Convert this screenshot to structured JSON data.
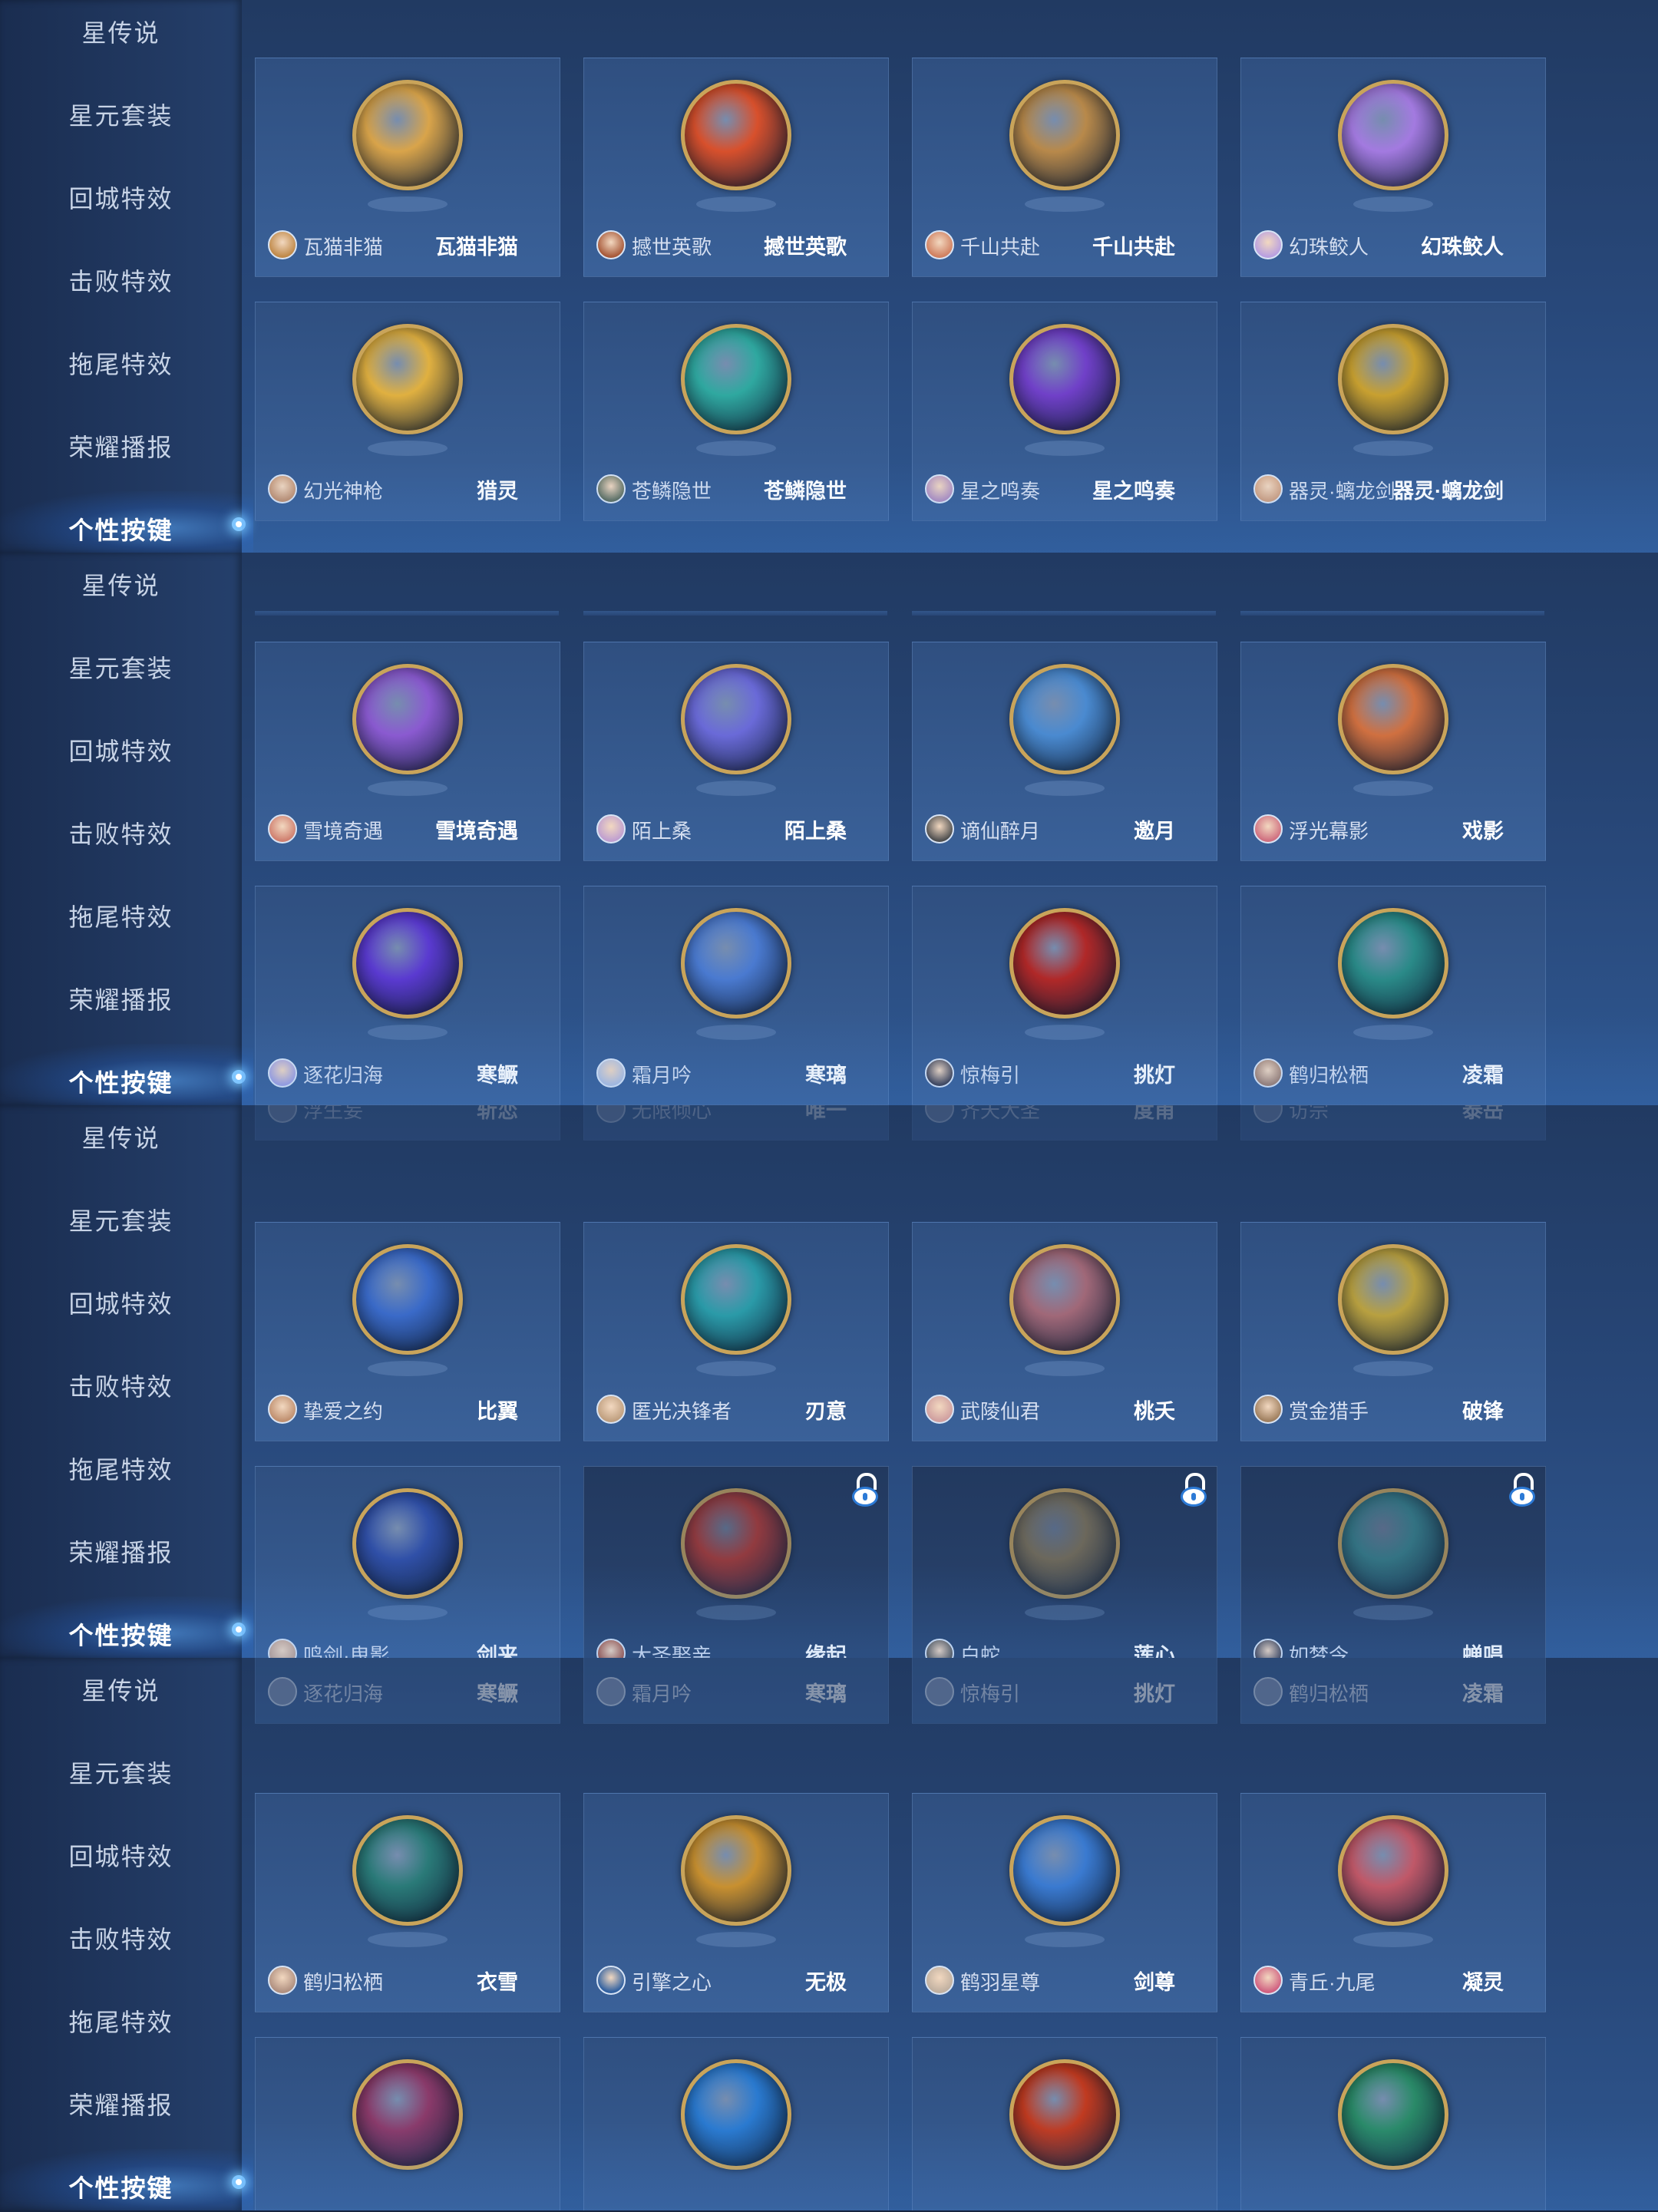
{
  "sidebar": {
    "items": [
      "星传说",
      "星元套装",
      "回城特效",
      "击败特效",
      "拖尾特效",
      "荣耀播报",
      "个性按键"
    ],
    "active": "个性按键"
  },
  "panels": [
    {
      "cards": [
        {
          "hero": "瓦猫非猫",
          "skin": "瓦猫非猫",
          "emblem_color": "#d9a44a",
          "avatar_color": "#c08a4a"
        },
        {
          "hero": "撼世英歌",
          "skin": "撼世英歌",
          "emblem_color": "#d8502c",
          "avatar_color": "#a85a3a"
        },
        {
          "hero": "千山共赴",
          "skin": "千山共赴",
          "emblem_color": "#b8894a",
          "avatar_color": "#d08060"
        },
        {
          "hero": "幻珠鲛人",
          "skin": "幻珠鲛人",
          "emblem_color": "#a37ae0",
          "avatar_color": "#b9a0e0"
        },
        {
          "hero": "幻光神枪",
          "skin": "猎灵",
          "emblem_color": "#e0b040",
          "avatar_color": "#c09070"
        },
        {
          "hero": "苍鳞隐世",
          "skin": "苍鳞隐世",
          "emblem_color": "#2fa8a0",
          "avatar_color": "#607060"
        },
        {
          "hero": "星之鸣奏",
          "skin": "星之鸣奏",
          "emblem_color": "#7040c8",
          "avatar_color": "#b090c0"
        },
        {
          "hero": "器灵·螭龙剑",
          "skin": "器灵·螭龙剑",
          "emblem_color": "#c8a030",
          "avatar_color": "#d0a080"
        }
      ]
    },
    {
      "cards": [
        {
          "hero": "雪境奇遇",
          "skin": "雪境奇遇",
          "emblem_color": "#8a5ad0",
          "avatar_color": "#d08070"
        },
        {
          "hero": "陌上桑",
          "skin": "陌上桑",
          "emblem_color": "#6a6ad8",
          "avatar_color": "#c0a0d0"
        },
        {
          "hero": "谪仙醉月",
          "skin": "邀月",
          "emblem_color": "#4a8ad0",
          "avatar_color": "#505050"
        },
        {
          "hero": "浮光幕影",
          "skin": "戏影",
          "emblem_color": "#d07040",
          "avatar_color": "#d07080"
        },
        {
          "hero": "逐花归海",
          "skin": "寒鳜",
          "emblem_color": "#5a3ad0",
          "avatar_color": "#a0a0e0"
        },
        {
          "hero": "霜月吟",
          "skin": "寒璃",
          "emblem_color": "#4a7ad0",
          "avatar_color": "#b0c0e0"
        },
        {
          "hero": "惊梅引",
          "skin": "挑灯",
          "emblem_color": "#b02828",
          "avatar_color": "#404050"
        },
        {
          "hero": "鹤归松栖",
          "skin": "凌霜",
          "emblem_color": "#2a8a88",
          "avatar_color": "#a08070"
        }
      ]
    },
    {
      "top_faded": [
        {
          "hero": "浮生妄",
          "skin": "斩恋"
        },
        {
          "hero": "无限倾心",
          "skin": "唯一"
        },
        {
          "hero": "齐天大圣",
          "skin": "度甫"
        },
        {
          "hero": "访宗",
          "skin": "泰岳"
        }
      ],
      "cards": [
        {
          "hero": "挚爱之约",
          "skin": "比翼",
          "emblem_color": "#3a6ac8",
          "avatar_color": "#c09070",
          "locked": false
        },
        {
          "hero": "匿光决锋者",
          "skin": "刃意",
          "emblem_color": "#2a9aa8",
          "avatar_color": "#c0a080",
          "locked": false
        },
        {
          "hero": "武陵仙君",
          "skin": "桃夭",
          "emblem_color": "#a06878",
          "avatar_color": "#d0a0a0",
          "locked": false
        },
        {
          "hero": "赏金猎手",
          "skin": "破锋",
          "emblem_color": "#b8a040",
          "avatar_color": "#a08060",
          "locked": false
        },
        {
          "hero": "鸣剑·曳影",
          "skin": "剑来",
          "emblem_color": "#3050a8",
          "avatar_color": "#c0a090",
          "locked": false
        },
        {
          "hero": "大圣娶亲",
          "skin": "缘起",
          "emblem_color": "#c03a30",
          "avatar_color": "#a05040",
          "locked": true
        },
        {
          "hero": "白蛇",
          "skin": "莲心",
          "emblem_color": "#8a7a58",
          "avatar_color": "#505050",
          "locked": true
        },
        {
          "hero": "如梦令",
          "skin": "蝉唱",
          "emblem_color": "#3a8a90",
          "avatar_color": "#404050",
          "locked": true
        }
      ]
    },
    {
      "top_faded": [
        {
          "hero": "逐花归海",
          "skin": "寒鳜"
        },
        {
          "hero": "霜月吟",
          "skin": "寒璃"
        },
        {
          "hero": "惊梅引",
          "skin": "挑灯"
        },
        {
          "hero": "鹤归松栖",
          "skin": "凌霜"
        }
      ],
      "cards": [
        {
          "hero": "鹤归松栖",
          "skin": "衣雪",
          "emblem_color": "#2a7a78",
          "avatar_color": "#b09080"
        },
        {
          "hero": "引擎之心",
          "skin": "无极",
          "emblem_color": "#c89030",
          "avatar_color": "#3060a0"
        },
        {
          "hero": "鹤羽星尊",
          "skin": "剑尊",
          "emblem_color": "#3a7ad0",
          "avatar_color": "#c0b0a0"
        },
        {
          "hero": "青丘·九尾",
          "skin": "凝灵",
          "emblem_color": "#c05868",
          "avatar_color": "#d06080"
        }
      ],
      "bottom_emblems": [
        {
          "emblem_color": "#8a3a6a"
        },
        {
          "emblem_color": "#2a7ad0"
        },
        {
          "emblem_color": "#c03a20"
        },
        {
          "emblem_color": "#2a8a68"
        }
      ]
    }
  ]
}
